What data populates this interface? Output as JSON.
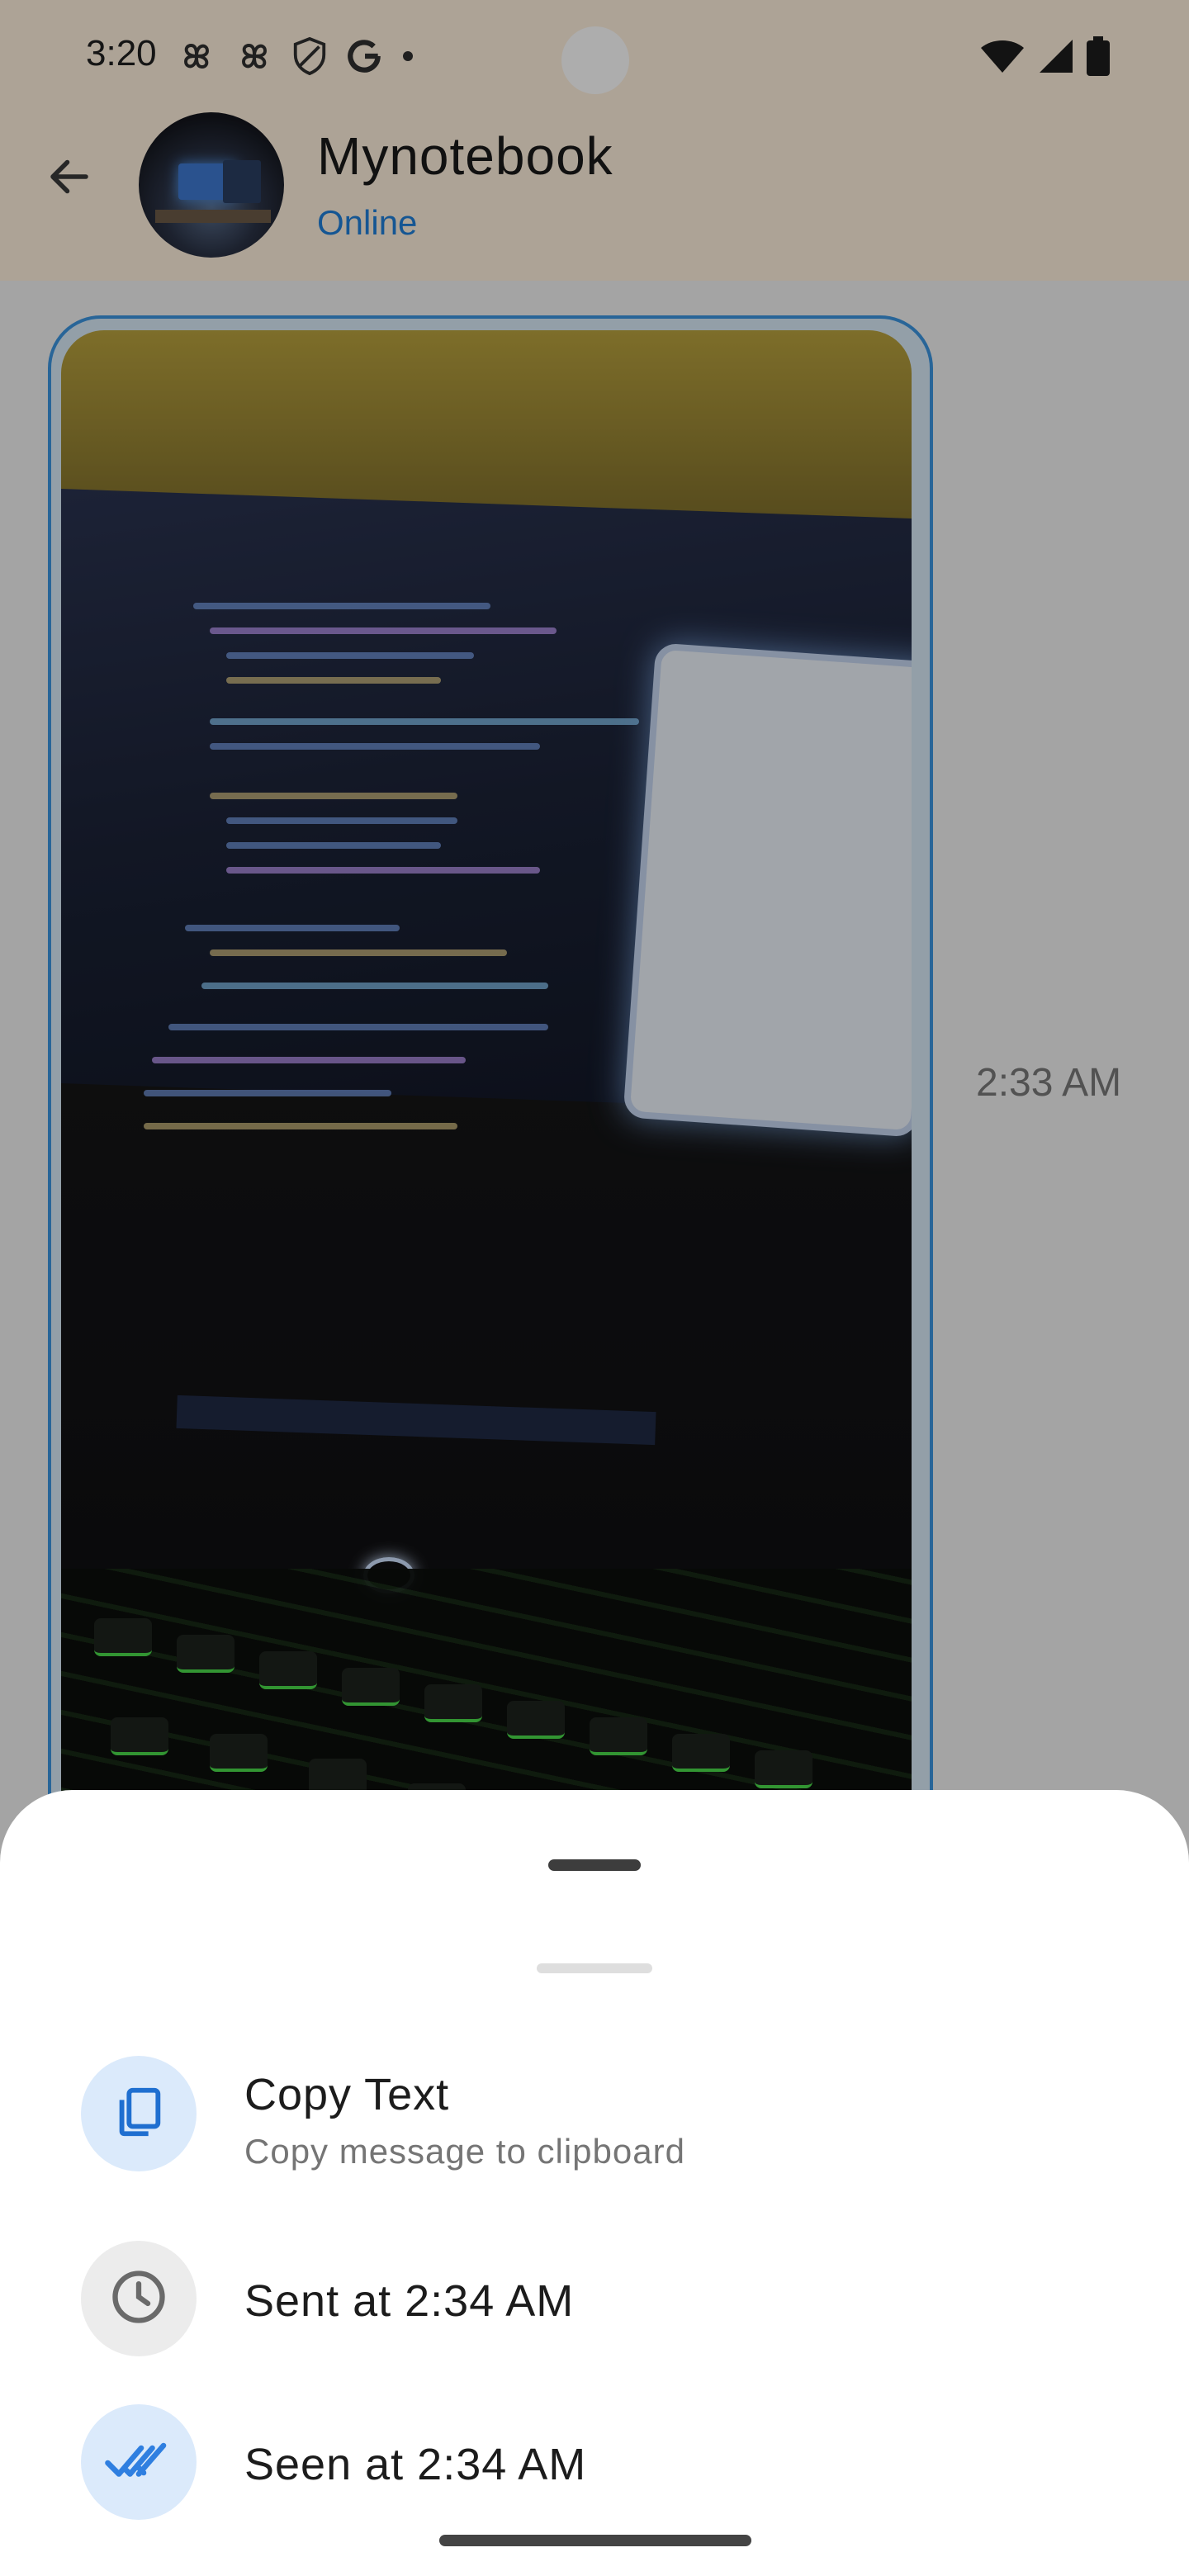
{
  "status_bar": {
    "time": "3:20",
    "left_icons": [
      "pinwheel-icon",
      "pinwheel-icon",
      "shield-icon",
      "google-g-icon",
      "dot-icon"
    ],
    "right_icons": [
      "wifi-icon",
      "signal-icon",
      "battery-icon"
    ]
  },
  "chat_header": {
    "name": "Mynotebook",
    "status": "Online",
    "status_color": "#1f7fd9"
  },
  "message": {
    "type": "image",
    "time": "2:33 AM",
    "border_color": "#3c95e0"
  },
  "bottom_sheet": {
    "options": [
      {
        "title": "Copy Text",
        "subtitle": "Copy message to clipboard",
        "icon": "copy-icon",
        "icon_color": "#1f6fd0",
        "bg_color": "#dbeafb"
      },
      {
        "title": "Sent at 2:34 AM",
        "icon": "clock-icon",
        "icon_color": "#6a6a6a",
        "bg_color": "#ececec"
      },
      {
        "title": "Seen at 2:34 AM",
        "icon": "double-check-icon",
        "icon_color": "#2f7fe0",
        "bg_color": "#dbeafb"
      }
    ]
  }
}
